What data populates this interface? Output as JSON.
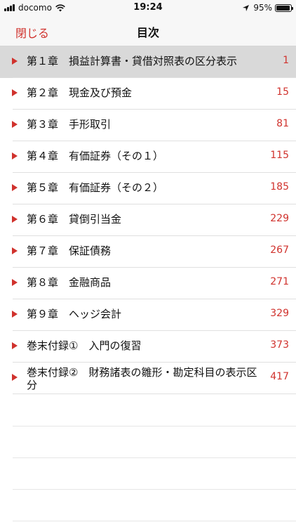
{
  "status": {
    "carrier": "docomo",
    "time": "19:24",
    "battery": "95%",
    "battery_level": 0.95
  },
  "nav": {
    "close_label": "閉じる",
    "title": "目次"
  },
  "toc": [
    {
      "label": "第１章　損益計算書・貸借対照表の区分表示",
      "page": "1"
    },
    {
      "label": "第２章　現金及び預金",
      "page": "15"
    },
    {
      "label": "第３章　手形取引",
      "page": "81"
    },
    {
      "label": "第４章　有価証券（その１）",
      "page": "115"
    },
    {
      "label": "第５章　有価証券（その２）",
      "page": "185"
    },
    {
      "label": "第６章　貸倒引当金",
      "page": "229"
    },
    {
      "label": "第７章　保証債務",
      "page": "267"
    },
    {
      "label": "第８章　金融商品",
      "page": "271"
    },
    {
      "label": "第９章　ヘッジ会計",
      "page": "329"
    },
    {
      "label": "巻末付録①　入門の復習",
      "page": "373"
    },
    {
      "label": "巻末付録②　財務諸表の雛形・勘定科目の表示区分",
      "page": "417"
    }
  ],
  "colors": {
    "accent": "#d0322d",
    "selected_row": "#d9d9d9"
  }
}
